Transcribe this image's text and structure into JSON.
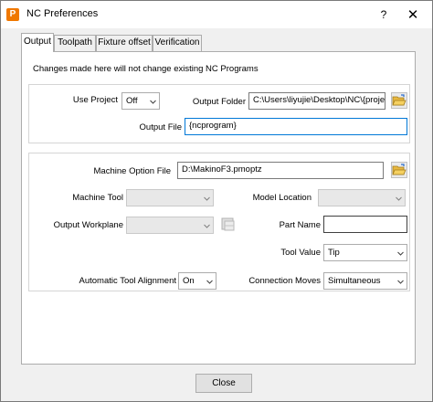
{
  "window": {
    "title": "NC Preferences",
    "help_label": "?",
    "close_label": "✕"
  },
  "tabs": [
    {
      "label": "Output",
      "active": true
    },
    {
      "label": "Toolpath"
    },
    {
      "label": "Fixture offset"
    },
    {
      "label": "Verification"
    }
  ],
  "note": "Changes made here will not change existing NC Programs",
  "output_group": {
    "use_project_label": "Use Project",
    "use_project_value": "Off",
    "output_folder_label": "Output Folder",
    "output_folder_value": "C:\\Users\\liyujie\\Desktop\\NC\\{proje",
    "output_file_label": "Output File",
    "output_file_value": "{ncprogram}"
  },
  "machine_group": {
    "machine_option_file_label": "Machine Option File",
    "machine_option_file_value": "D:\\MakinoF3.pmoptz",
    "machine_tool_label": "Machine Tool",
    "machine_tool_value": "",
    "model_location_label": "Model Location",
    "model_location_value": "",
    "output_workplane_label": "Output Workplane",
    "output_workplane_value": "",
    "part_name_label": "Part Name",
    "part_name_value": "",
    "tool_value_label": "Tool Value",
    "tool_value_value": "Tip",
    "auto_tool_alignment_label": "Automatic Tool Alignment",
    "auto_tool_alignment_value": "On",
    "connection_moves_label": "Connection Moves",
    "connection_moves_value": "Simultaneous"
  },
  "footer": {
    "close_label": "Close"
  },
  "icons": {
    "app": "app-icon",
    "folder_browse": "folder-open-icon",
    "workplane_pick": "workplane-icon",
    "dropdown": "chevron-down-icon"
  },
  "colors": {
    "accent": "#0078d7",
    "app_icon": "#f07800",
    "folder": "#e8b840"
  }
}
